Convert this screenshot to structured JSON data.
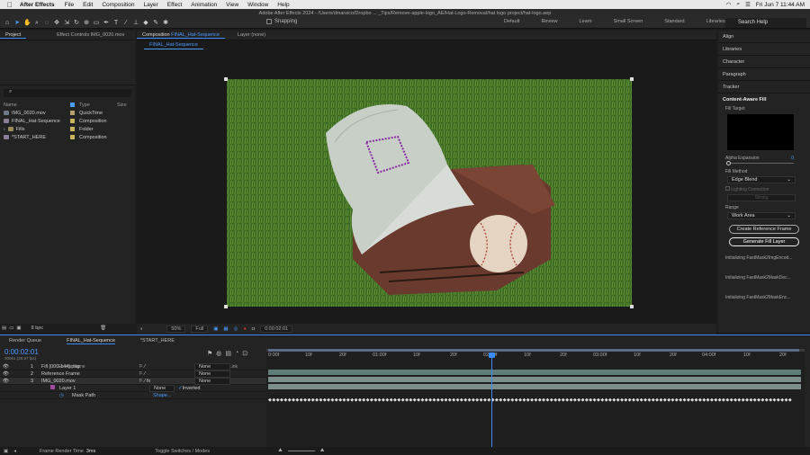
{
  "menubar": {
    "app": "After Effects",
    "items": [
      "File",
      "Edit",
      "Composition",
      "Layer",
      "Effect",
      "Animation",
      "View",
      "Window",
      "Help"
    ],
    "datetime": "Fri Jun 7  11:44 AM"
  },
  "window_title": "Adobe After Effects 2024 - /Users/dmarsico/Dropbo ... _Tips/Remove-apple-logo_AE/Hat-Logo-Removal/hat logo project/hat-logo.aep",
  "toolbar": {
    "snapping": "Snapping",
    "workspaces": [
      "Default",
      "Review",
      "Learn",
      "Small Screen",
      "Standard",
      "Libraries"
    ],
    "help_search": "Search Help"
  },
  "project_panel": {
    "tab": "Project",
    "tab2": "Effect Controls IMG_0020.mov",
    "columns": {
      "name": "Name",
      "type": "Type",
      "size": "Size"
    },
    "rows": [
      {
        "name": "IMG_0020.mov",
        "type": "QuickTime",
        "size": "",
        "color": "#b5a26a"
      },
      {
        "name": "FINAL_Hat-Sequence",
        "type": "Composition",
        "size": "",
        "color": "#c8b55a"
      },
      {
        "name": "Fills",
        "type": "Folder",
        "size": "",
        "color": "#c8b55a"
      },
      {
        "name": "*START_HERE",
        "type": "Composition",
        "size": "",
        "color": "#c8b55a"
      }
    ],
    "bpc": "8 bpc"
  },
  "viewer": {
    "tab_comp_prefix": "Composition",
    "tab_comp_name": "FINAL_Hat-Sequence",
    "tab_layer": "Layer (none)",
    "sequence_tab": "FINAL_Hat-Sequence",
    "zoom": "50%",
    "resolution": "Full",
    "time": "0:00:02:01"
  },
  "right_panel": {
    "items": [
      "Align",
      "Libraries",
      "Character",
      "Paragraph",
      "Tracker"
    ],
    "caf_title": "Content-Aware Fill",
    "fill_target": "Fill Target",
    "alpha_expansion": "Alpha Expansion",
    "alpha_value": "0",
    "fill_method_label": "Fill Method",
    "fill_method": "Edge Blend",
    "lighting_correction": "Lighting Correction",
    "strong": "Strong",
    "range_label": "Range",
    "range": "Work Area",
    "create_ref": "Create Reference Frame",
    "generate": "Generate Fill Layer",
    "statuses": [
      "Initializing FastMask2ImgEncod...",
      "Initializing FastMask2MaskDec...",
      "Initializing FastMask2MaskEnc..."
    ]
  },
  "timeline": {
    "tabs": [
      "Render Queue",
      "FINAL_Hat-Sequence",
      "*START_HERE"
    ],
    "timecode": "0:00:02:01",
    "fps": "00061 (29.97 fps)",
    "col_source": "Source Name",
    "col_parent": "Parent & Link",
    "layers": [
      {
        "num": "1",
        "name": "Fill [000-144].png",
        "parent": "None"
      },
      {
        "num": "2",
        "name": "Reference Frame",
        "parent": "None"
      },
      {
        "num": "3",
        "name": "IMG_0020.mov",
        "parent": "None"
      }
    ],
    "mask": {
      "name": "Layer 1",
      "mode": "None",
      "inverted": "Inverted",
      "path_label": "Mask Path",
      "path_value": "Shape..."
    },
    "ruler": [
      "0:00f",
      "10f",
      "20f",
      "01:00f",
      "10f",
      "20f",
      "02:00f",
      "10f",
      "20f",
      "03:00f",
      "10f",
      "20f",
      "04:00f",
      "10f",
      "20f"
    ],
    "status": "Frame Render Time",
    "render_time": "3ms",
    "toggle": "Toggle Switches / Modes"
  }
}
